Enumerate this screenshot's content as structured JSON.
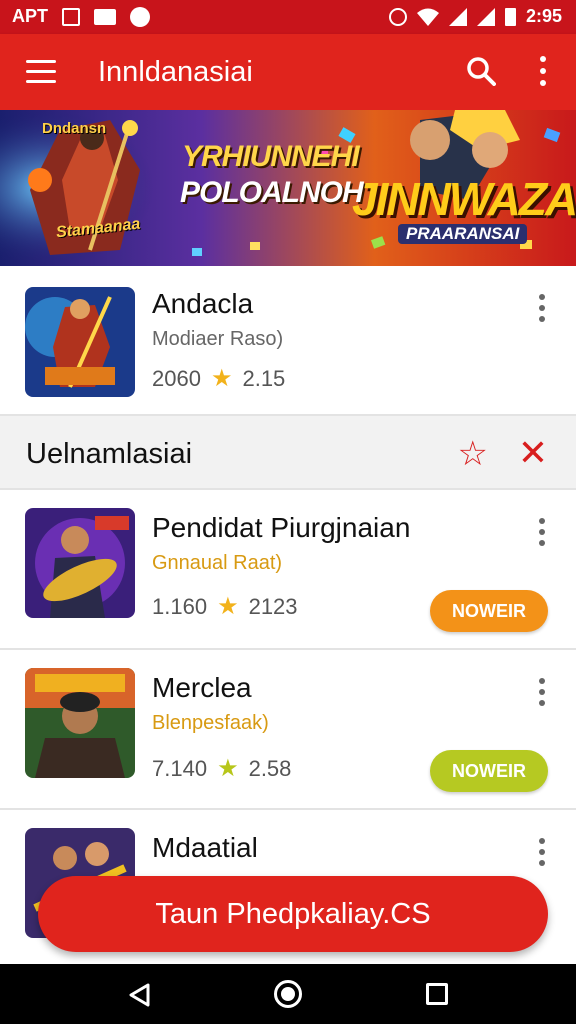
{
  "status_bar": {
    "carrier": "APT",
    "time": "2:95"
  },
  "app_bar": {
    "title": "Innldanasiai"
  },
  "banner": {
    "tag": "Dndansn",
    "caption_left": "Stamaanaa",
    "line1": "YRHIUNNEHI",
    "line2": "POLOALNOH",
    "line3": "JINNWAZAN",
    "line4": "PRAARANSAI"
  },
  "featured": {
    "title": "Andacla",
    "subtitle": "Modiaer Raso)",
    "count": "2060",
    "rating": "2.15"
  },
  "section": {
    "title": "Uelnamlasiai"
  },
  "items": [
    {
      "title": "Pendidat Piurgjnaian",
      "subtitle": "Gnnaual Raat)",
      "count": "1.160",
      "rating": "2123",
      "action": "NOWEIR",
      "action_color": "#f39218"
    },
    {
      "title": "Merclea",
      "subtitle": "Blenpesfaak)",
      "count": "7.140",
      "rating": "2.58",
      "action": "NOWEIR",
      "action_color": "#b6c922"
    },
    {
      "title": "Mdaatial"
    }
  ],
  "fab": {
    "label": "Taun Phedpkaliay.CS"
  },
  "colors": {
    "primary": "#e0241d",
    "status": "#c8141b"
  },
  "icons": [
    "hamburger-icon",
    "search-icon",
    "more-vert-icon",
    "star-icon",
    "close-icon",
    "back-icon",
    "home-icon",
    "recents-icon"
  ]
}
